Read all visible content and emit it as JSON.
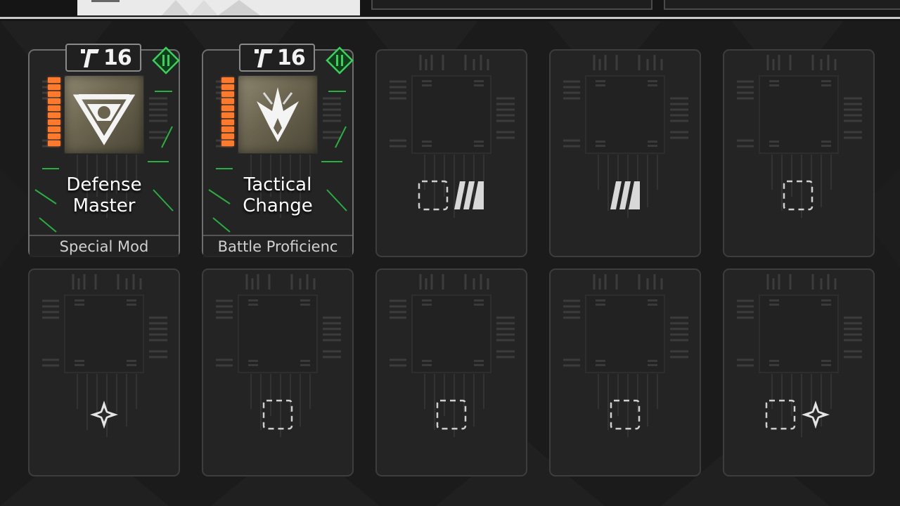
{
  "colors": {
    "background": "#1b1b1b",
    "card": "#262626",
    "card_border": "#3d3d3d",
    "energy_orange": "#ff7a2c",
    "tier_green": "#39d15b",
    "circuit_green": "#2bdc4a",
    "text": "#ffffff"
  },
  "equipped_mods": [
    {
      "level": "16",
      "name": "Defense\nMaster",
      "type": "Special Mod",
      "icon": "defense-shield-icon",
      "tier_icon": "green-tier-icon",
      "energy_segments": 11
    },
    {
      "level": "16",
      "name": "Tactical\nChange",
      "type": "Battle Proficienc",
      "icon": "tactical-arrow-icon",
      "tier_icon": "green-tier-icon",
      "energy_segments": 11
    }
  ],
  "empty_slots": [
    {
      "slot": 3,
      "icons": [
        "dashed-square-icon",
        "triple-bar-icon"
      ]
    },
    {
      "slot": 4,
      "icons": [
        "triple-bar-icon"
      ]
    },
    {
      "slot": 5,
      "icons": [
        "dashed-square-icon"
      ]
    },
    {
      "slot": 6,
      "icons": [
        "four-point-star-icon"
      ]
    },
    {
      "slot": 7,
      "icons": [
        "dashed-square-icon"
      ]
    },
    {
      "slot": 8,
      "icons": [
        "dashed-square-icon"
      ]
    },
    {
      "slot": 9,
      "icons": [
        "dashed-square-icon"
      ]
    },
    {
      "slot": 10,
      "icons": [
        "dashed-square-icon",
        "four-point-star-icon"
      ]
    }
  ]
}
